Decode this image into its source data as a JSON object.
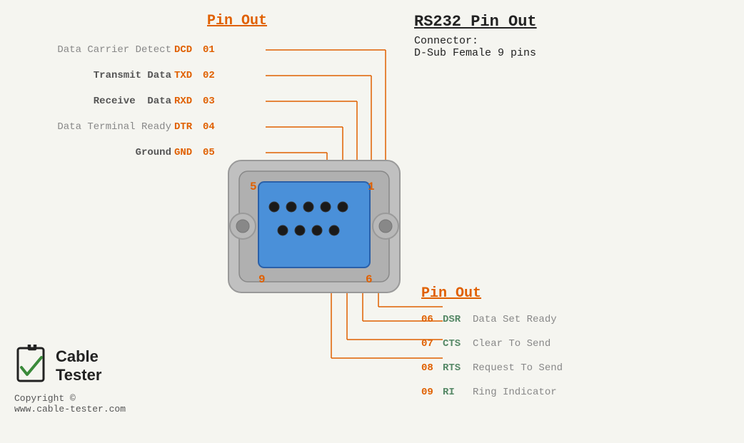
{
  "title": "RS232 Pin Out",
  "connector": {
    "label": "Connector:",
    "type": "D-Sub Female 9 pins"
  },
  "pinout_label_top": "Pin Out",
  "pinout_label_bottom": "Pin Out",
  "left_pins": [
    {
      "desc_plain": "Data Carrier Detect",
      "abbr": "DCD",
      "num": "01",
      "bold": false
    },
    {
      "desc_bold": "Transmit Data",
      "abbr": "TXD",
      "num": "02",
      "bold": true
    },
    {
      "desc_bold": "Receive  Data",
      "abbr": "RXD",
      "num": "03",
      "bold": true
    },
    {
      "desc_plain": "Data Terminal Ready",
      "abbr": "DTR",
      "num": "04",
      "bold": false
    },
    {
      "desc_bold": "Ground",
      "abbr": "GND",
      "num": "05",
      "bold": true
    }
  ],
  "right_pins": [
    {
      "num": "06",
      "abbr": "DSR",
      "desc": "Data Set Ready"
    },
    {
      "num": "07",
      "abbr": "CTS",
      "desc": "Clear To Send"
    },
    {
      "num": "08",
      "abbr": "RTS",
      "desc": "Request To Send"
    },
    {
      "num": "09",
      "abbr": "RI",
      "desc": " Ring Indicator"
    }
  ],
  "corner_labels": {
    "top_left": "5",
    "top_right": "1",
    "bottom_left": "9",
    "bottom_right": "6"
  },
  "logo": {
    "line1": "Cable",
    "line2": "Tester",
    "copyright": "Copyright ©",
    "website": "www.cable-tester.com"
  },
  "colors": {
    "orange": "#e06000",
    "green_abbr": "#558866",
    "gray_text": "#888888",
    "dark": "#222222"
  }
}
